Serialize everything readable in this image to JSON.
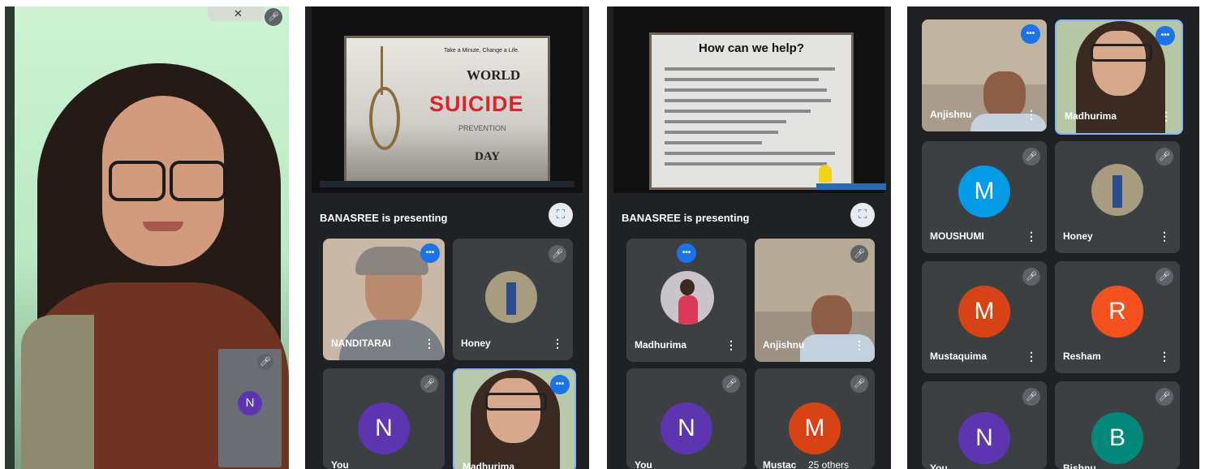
{
  "panel1": {
    "self_initial": "N",
    "avatar_color": "#5e35b1"
  },
  "panel2": {
    "slide": {
      "tagline": "Take a Minute, Change a Life.",
      "line1": "WORLD",
      "line2": "SUICIDE",
      "line3": "PREVENTION",
      "line4": "DAY"
    },
    "presenting_text": "BANASREE is presenting",
    "tiles": [
      {
        "name": "NANDITARAI"
      },
      {
        "name": "Honey"
      },
      {
        "name": "You",
        "initial": "N"
      },
      {
        "name": "Madhurima"
      }
    ]
  },
  "panel3": {
    "slide": {
      "title": "How can we help?"
    },
    "presenting_text": "BANASREE is presenting",
    "tiles": [
      {
        "name": "Madhurima"
      },
      {
        "name": "Anjishnu"
      },
      {
        "name": "You",
        "initial": "N"
      },
      {
        "name": "Mustac",
        "initial": "M",
        "extra": "25 others"
      }
    ]
  },
  "panel4": {
    "tiles": [
      {
        "name": "Anjishnu"
      },
      {
        "name": "Madhurima"
      },
      {
        "name": "MOUSHUMI",
        "initial": "M"
      },
      {
        "name": "Honey"
      },
      {
        "name": "Mustaquima",
        "initial": "M"
      },
      {
        "name": "Resham",
        "initial": "R"
      },
      {
        "name": "You",
        "initial": "N"
      },
      {
        "name": "Bishnu",
        "initial": "B"
      }
    ]
  },
  "colors": {
    "meet_bg": "#202124",
    "tile_bg": "#3c4043",
    "speaking_blue": "#1a73e8",
    "avatar_purple": "#5e35b1",
    "avatar_blue": "#039be5",
    "avatar_red": "#e64a19",
    "avatar_redorange": "#f4511e",
    "avatar_teal": "#00897b"
  },
  "icons": {
    "mic_off": "mic-off-icon",
    "speaking": "speaking-indicator-icon",
    "more": "more-vert-icon",
    "fullscreen": "fullscreen-icon"
  }
}
